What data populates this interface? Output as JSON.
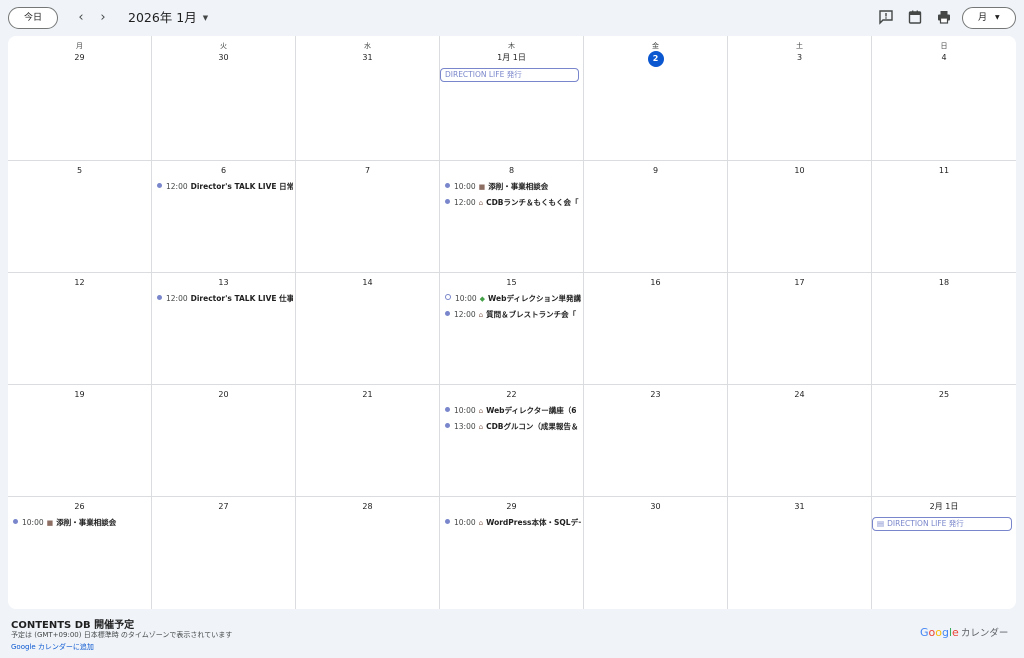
{
  "toolbar": {
    "today_label": "今日",
    "prev_icon": "chevron-left-icon",
    "next_icon": "chevron-right-icon",
    "month_label": "2026年 1月",
    "feedback_icon": "feedback-icon",
    "calendar_icon": "calendar-icon",
    "print_icon": "print-icon",
    "view_label": "月",
    "accent": "#0b57d0"
  },
  "weekdays": [
    "月",
    "火",
    "水",
    "木",
    "金",
    "土",
    "日"
  ],
  "weeks": [
    {
      "days": [
        "29",
        "30",
        "31",
        "1月 1日",
        "2",
        "3",
        "4"
      ]
    },
    {
      "days": [
        "5",
        "6",
        "7",
        "8",
        "9",
        "10",
        "11"
      ]
    },
    {
      "days": [
        "12",
        "13",
        "14",
        "15",
        "16",
        "17",
        "18"
      ]
    },
    {
      "days": [
        "19",
        "20",
        "21",
        "22",
        "23",
        "24",
        "25"
      ]
    },
    {
      "days": [
        "26",
        "27",
        "28",
        "29",
        "30",
        "31",
        "2月 1日"
      ]
    }
  ],
  "today": "2",
  "events": {
    "w0d3_allday": "DIRECTION LIFE 発行",
    "w1d1_e0": {
      "time": "12:00",
      "title": "Director's TALK LIVE 日常編"
    },
    "w1d3_e0": {
      "time": "10:00",
      "icon": "graduation-cap-icon",
      "title": "添削・事業相談会"
    },
    "w1d3_e1": {
      "time": "12:00",
      "icon": "house-icon",
      "title": "CDBランチ＆もくもく会「"
    },
    "w2d1_e0": {
      "time": "12:00",
      "title": "Director's TALK LIVE 仕事編"
    },
    "w2d3_e0": {
      "time": "10:00",
      "icon": "beginner-mark-icon",
      "title": "Webディレクション単発講"
    },
    "w2d3_e1": {
      "time": "12:00",
      "icon": "house-icon",
      "title": "質問＆ブレストランチ会「"
    },
    "w3d3_e0": {
      "time": "10:00",
      "icon": "house-icon",
      "title": "Webディレクター講座（6"
    },
    "w3d3_e1": {
      "time": "13:00",
      "icon": "house-icon",
      "title": "CDBグルコン（成果報告＆"
    },
    "w4d0_e0": {
      "time": "10:00",
      "icon": "graduation-cap-icon",
      "title": "添削・事業相談会"
    },
    "w4d3_e0": {
      "time": "10:00",
      "icon": "house-icon",
      "title": "WordPress本体・SQLデー"
    },
    "w4d6_allday": "DIRECTION LIFE 発行"
  },
  "event_color": "#7986cb",
  "footer": {
    "title": "CONTENTS DB 開催予定",
    "timezone": "予定は (GMT+09:00) 日本標準時 のタイムゾーンで表示されています",
    "add_link": "Google カレンダーに追加",
    "brand_google": "Google",
    "brand_calendar": "カレンダー"
  }
}
